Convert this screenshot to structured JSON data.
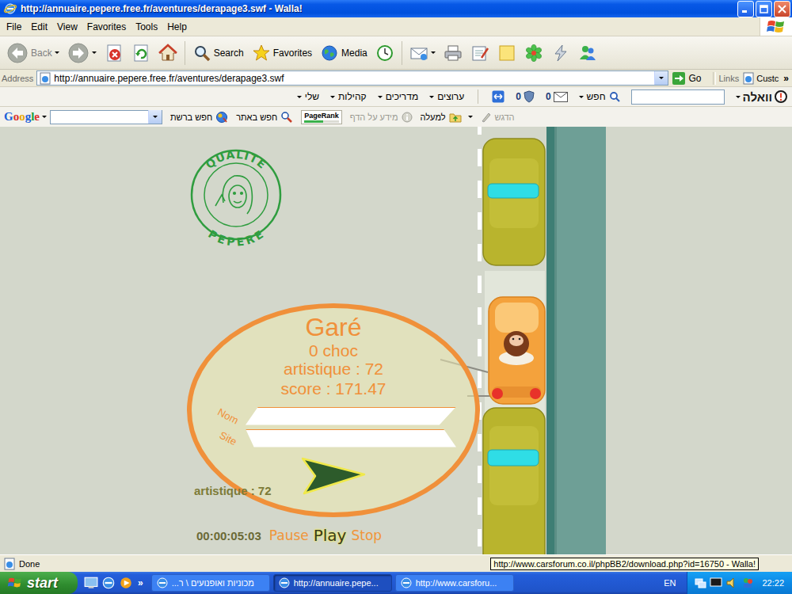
{
  "window": {
    "title": "http://annuaire.pepere.free.fr/aventures/derapage3.swf - Walla!"
  },
  "menu": [
    "File",
    "Edit",
    "View",
    "Favorites",
    "Tools",
    "Help"
  ],
  "toolbar": [
    {
      "kind": "back",
      "label": "Back",
      "disabled": true,
      "dropdown": true
    },
    {
      "kind": "forward",
      "disabled": true,
      "dropdown": true
    },
    {
      "kind": "stop",
      "disabled": false,
      "dropdown": false
    },
    {
      "kind": "refresh",
      "disabled": false,
      "dropdown": false
    },
    {
      "kind": "home",
      "disabled": false,
      "dropdown": false
    },
    {
      "kind": "separator"
    },
    {
      "kind": "search",
      "label": "Search",
      "disabled": false,
      "dropdown": false
    },
    {
      "kind": "favorites",
      "label": "Favorites",
      "disabled": false,
      "dropdown": false
    },
    {
      "kind": "media",
      "label": "Media",
      "disabled": false,
      "dropdown": false
    },
    {
      "kind": "history",
      "disabled": false,
      "dropdown": false
    },
    {
      "kind": "separator"
    },
    {
      "kind": "mail",
      "disabled": false,
      "dropdown": true
    },
    {
      "kind": "print",
      "disabled": false,
      "dropdown": false
    },
    {
      "kind": "edit",
      "disabled": false,
      "dropdown": false
    },
    {
      "kind": "discuss",
      "disabled": false,
      "dropdown": false
    },
    {
      "kind": "icq",
      "disabled": false,
      "dropdown": false
    },
    {
      "kind": "messenger",
      "disabled": false,
      "dropdown": false
    },
    {
      "kind": "people",
      "disabled": false,
      "dropdown": false
    }
  ],
  "address": {
    "label": "Address",
    "url": "http://annuaire.pepere.free.fr/aventures/derapage3.swf",
    "go": "Go",
    "links": "Links",
    "custom": "Custc",
    "more": "»"
  },
  "walla_toolbar": {
    "menus": [
      "שלי",
      "קהילות",
      "מדריכים",
      "ערוצים"
    ],
    "shield_count": "0",
    "mail_count": "0",
    "search_label": "חפש",
    "logo": "וואלה"
  },
  "google_toolbar": {
    "logo": "Google",
    "buttons": [
      {
        "kind": "web",
        "label": "חפש ברשת",
        "disabled": false,
        "dropdown": false
      },
      {
        "kind": "site",
        "label": "חפש באתר",
        "disabled": false,
        "dropdown": false
      },
      {
        "kind": "pagerank",
        "label": "PageRank",
        "disabled": false,
        "dropdown": false
      },
      {
        "kind": "info",
        "label": "מידע על הדף",
        "disabled": true,
        "dropdown": false
      },
      {
        "kind": "up",
        "label": "למעלה",
        "disabled": false,
        "dropdown": true
      },
      {
        "kind": "highlight",
        "label": "הדגש",
        "disabled": true,
        "dropdown": false
      }
    ]
  },
  "game": {
    "stamp_top": "QUALITE",
    "stamp_bottom": "PEPERE",
    "result": {
      "title": "Garé",
      "shocks": "0 choc",
      "artistic": "artistique : 72",
      "score": "score : 171.47",
      "fields": [
        {
          "label": "Nom"
        },
        {
          "label": "Site"
        }
      ]
    },
    "artistic": "artistique : 72",
    "timer": "00:00:05:03",
    "controls": [
      {
        "label": "Pause",
        "selected": false
      },
      {
        "label": "Play",
        "selected": true
      },
      {
        "label": "Stop",
        "selected": false
      }
    ]
  },
  "status_bar": {
    "text": "Done",
    "tooltip": "http://www.carsforum.co.il/phpBB2/download.php?id=16750 - Walla!"
  },
  "taskbar": {
    "start": "start",
    "more": "»",
    "tasks": [
      {
        "label": "מכוניות ואופנועים \\ ר...",
        "selected": false
      },
      {
        "label": "http://annuaire.pepe...",
        "selected": true
      },
      {
        "label": "http://www.carsforu...",
        "selected": false
      }
    ],
    "language": "EN",
    "clock": "22:22"
  }
}
